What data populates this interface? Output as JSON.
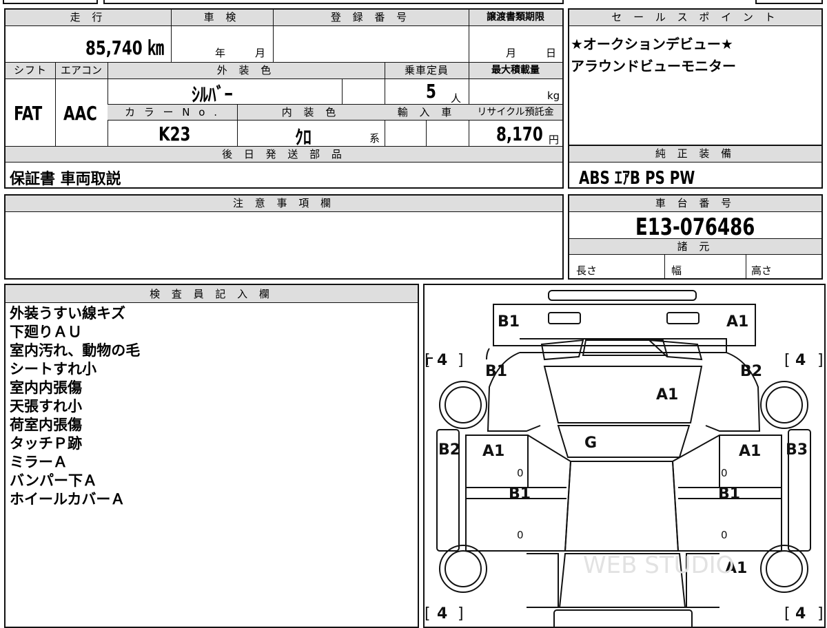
{
  "vehicle": {
    "labels": {
      "mileage": "走 行",
      "inspection": "車 検",
      "registration": "登 録 番 号",
      "transfer_deadline": "譲渡書類期限",
      "shift": "シフト",
      "aircon": "エアコン",
      "exterior_color": "外 装 色",
      "capacity": "乗車定員",
      "max_load": "最大積載量",
      "color_no": "カ ラ ー N o .",
      "interior_color": "内 装 色",
      "import": "輸 入 車",
      "recycle": "リサイクル預託金",
      "later_parts": "後 日 発 送 部 品"
    },
    "mileage": "85,740 ㎞",
    "inspection_year_unit": "年",
    "inspection_month_unit": "月",
    "deadline_month_unit": "月",
    "deadline_day_unit": "日",
    "shift": "FAT",
    "aircon": "AAC",
    "exterior_color": "ｼﾙﾊﾞｰ",
    "capacity": "5",
    "capacity_unit": "人",
    "max_load_unit": "kg",
    "color_no": "K23",
    "interior_color": "ｸﾛ",
    "interior_suffix": "系",
    "recycle_fee": "8,170",
    "recycle_unit": "円",
    "later_parts": "保証書 車両取説"
  },
  "sales_points": {
    "label": "セ ー ル ス ポ イ ン ト",
    "lines": [
      "★オークションデビュー★",
      "アラウンドビューモニター"
    ]
  },
  "genuine_equipment": {
    "label": "純 正 装 備",
    "items": "ABS ｴｱB PS PW"
  },
  "notes": {
    "label": "注 意 事 項 欄"
  },
  "chassis": {
    "label": "車 台 番 号",
    "number": "E13-076486"
  },
  "specs": {
    "label": "諸 元",
    "length": "長さ",
    "width": "幅",
    "height": "高さ"
  },
  "inspector": {
    "label": "検 査 員 記 入 欄",
    "remarks": [
      "外装うすい線キズ",
      "下廻りＡＵ",
      "室内汚れ、動物の毛",
      "シートすれ小",
      "室内内張傷",
      "天張すれ小",
      "荷室内張傷",
      "タッチＰ跡",
      "ミラーＡ",
      "バンパー下Ａ",
      "ホイールカバーＡ"
    ]
  },
  "diagram": {
    "marks": {
      "front_left": "B1",
      "front_right": "A1",
      "fender_left": "B1",
      "fender_right": "B2",
      "hood": "A1",
      "windshield": "G",
      "side_left": "B2",
      "side_right": "B3",
      "front_door_left": "A1",
      "front_door_right": "A1",
      "rear_door_left": "B1",
      "rear_door_right": "B1",
      "rear_right": "A1"
    },
    "tires": {
      "front_left": "4",
      "front_right": "4",
      "rear_left": "4",
      "rear_right": "4"
    },
    "zero": "0",
    "watermark": "WEB STUDIO"
  }
}
